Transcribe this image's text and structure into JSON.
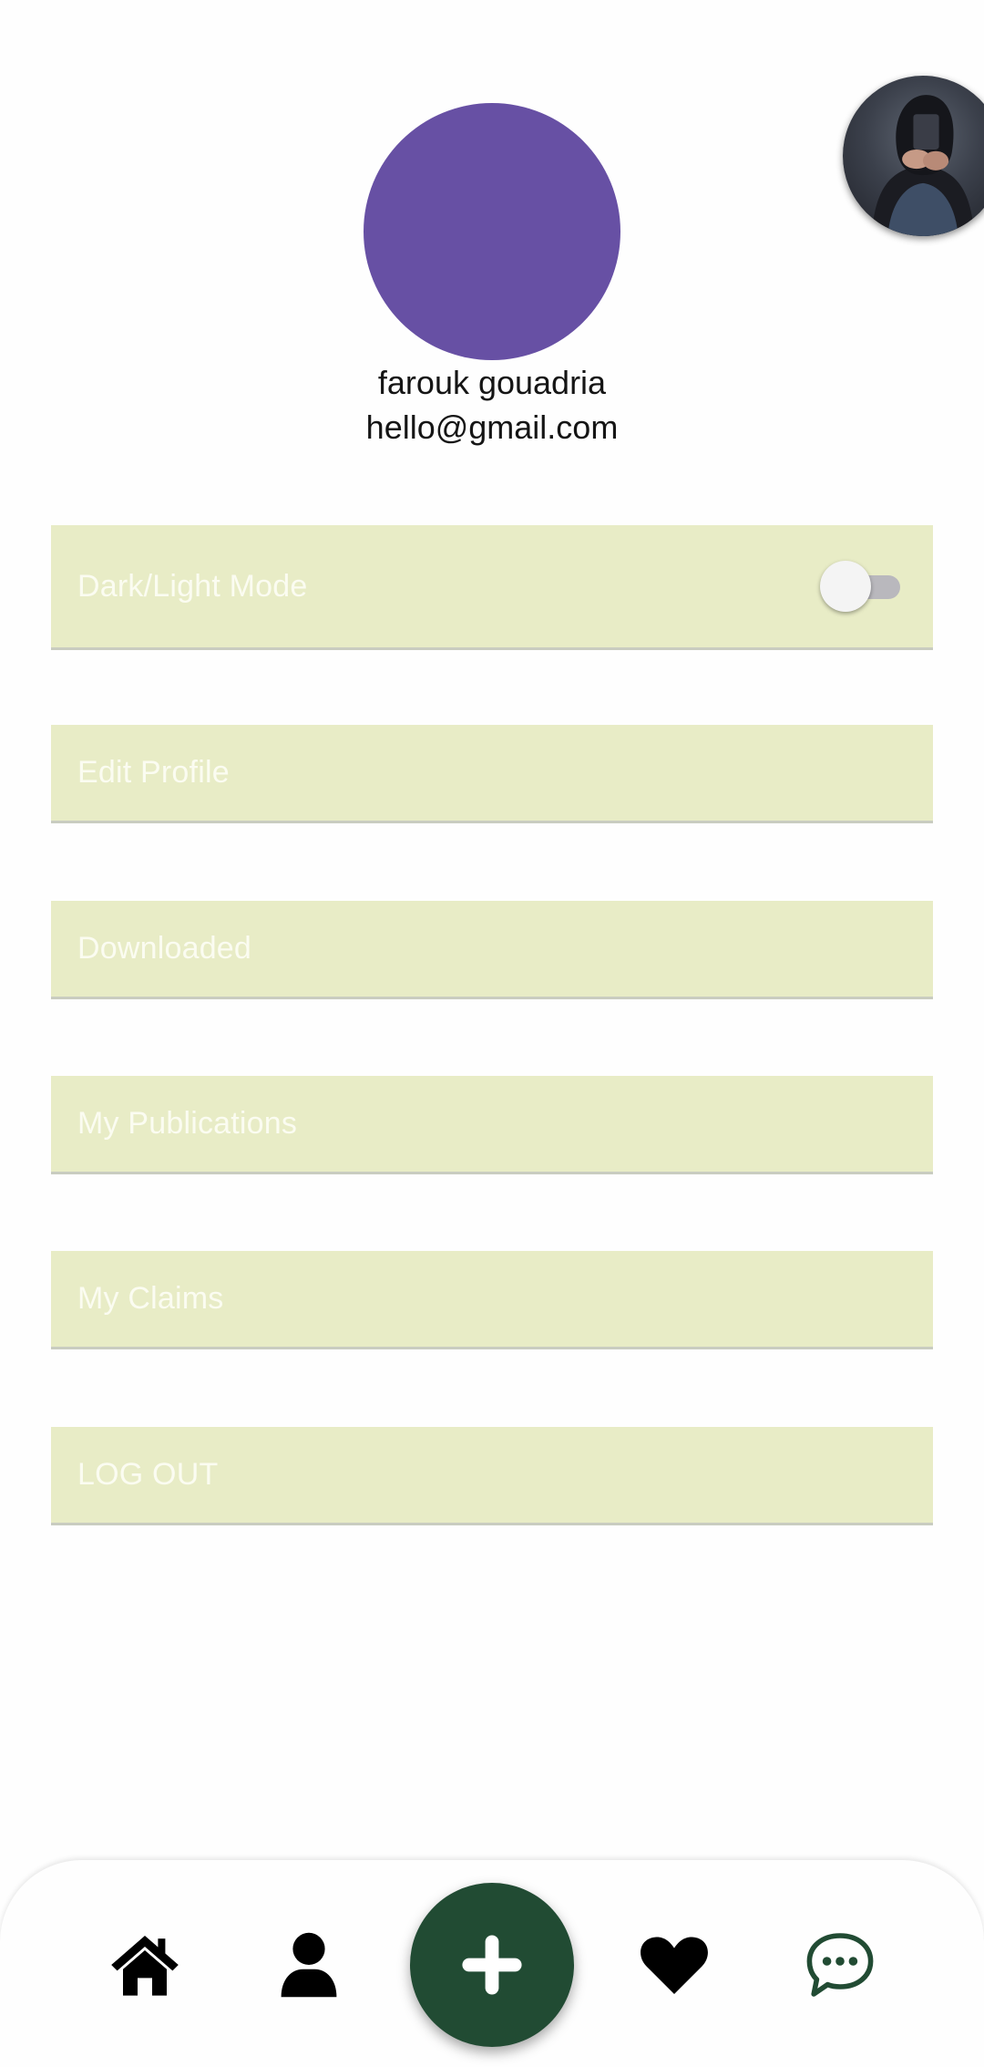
{
  "profile": {
    "name": "farouk gouadria",
    "email": "hello@gmail.com",
    "accent_color": "#6750a4"
  },
  "menu": {
    "item_background": "#e8ecc6",
    "items": [
      {
        "label": "Dark/Light Mode",
        "has_toggle": true,
        "toggle_on": false
      },
      {
        "label": "Edit Profile"
      },
      {
        "label": "Downloaded"
      },
      {
        "label": "My Publications"
      },
      {
        "label": "My Claims"
      },
      {
        "label": "LOG OUT"
      }
    ]
  },
  "bottom_nav": {
    "fab_color": "#214b33",
    "icons": [
      "home-icon",
      "person-icon",
      "plus-icon",
      "heart-icon",
      "chat-icon"
    ]
  }
}
